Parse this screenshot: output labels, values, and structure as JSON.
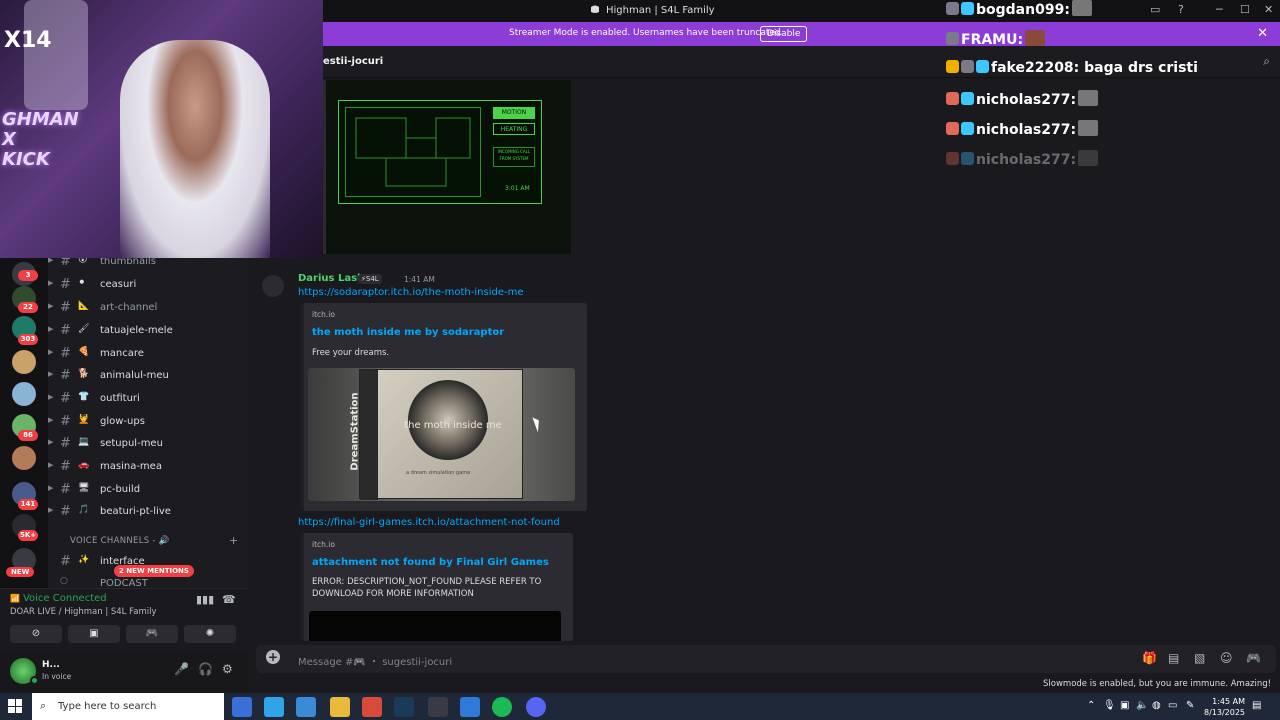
{
  "titlebar": {
    "title": "Highman | S4L Family",
    "minimize": "─",
    "maximize": "☐",
    "close": "✕"
  },
  "banner": {
    "text": "Streamer Mode is enabled. Usernames have been truncated.",
    "button": "Disable",
    "close": "✕"
  },
  "channel_header": {
    "name": "estii-jocuri"
  },
  "webcam": {
    "logo": "X14",
    "neon_text": "GHMAN\nX\nKICK"
  },
  "server_badges": [
    "3",
    "22",
    "303",
    "86",
    "141",
    "5K+"
  ],
  "channels": [
    {
      "emoji": "😲",
      "label": "thumbnails",
      "muted": true
    },
    {
      "emoji": "⚫",
      "label": "ceasuri",
      "muted": false
    },
    {
      "emoji": "📐",
      "label": "art-channel",
      "muted": true
    },
    {
      "emoji": "🖌",
      "label": "tatuajele-mele",
      "muted": false
    },
    {
      "emoji": "🍕",
      "label": "mancare",
      "muted": false
    },
    {
      "emoji": "🐕",
      "label": "animalul-meu",
      "muted": false
    },
    {
      "emoji": "👕",
      "label": "outfituri",
      "muted": false
    },
    {
      "emoji": "💆",
      "label": "glow-ups",
      "muted": false
    },
    {
      "emoji": "💻",
      "label": "setupul-meu",
      "muted": false
    },
    {
      "emoji": "🚗",
      "label": "masina-mea",
      "muted": false
    },
    {
      "emoji": "🖥",
      "label": "pc-build",
      "muted": false
    },
    {
      "emoji": "🎵",
      "label": "beaturi-pt-live",
      "muted": false
    }
  ],
  "voice_section": {
    "header": "VOICE CHANNELS - 🔊",
    "first_channel": "interface",
    "second_channel": "PODCAST"
  },
  "mentions_pill": "2 NEW MENTIONS",
  "new_pill": "NEW",
  "voice_panel": {
    "status": "Voice Connected",
    "room": "DOAR LIVE / Highman | S4L Family"
  },
  "user": {
    "name": "H...",
    "status": "In voice"
  },
  "monitor": {
    "motion": "MOTION",
    "heating": "HEATING",
    "note": "INCOMING CALL FROM SYSTEM",
    "time": "3:01 AM"
  },
  "message": {
    "author": "Darius Laslo",
    "tag": "⚡S4L",
    "time": "1:41 AM",
    "link1": "https://sodaraptor.itch.io/the-moth-inside-me",
    "embed1": {
      "provider": "itch.io",
      "title": "the moth inside me by sodaraptor",
      "description": "Free your dreams."
    },
    "cover": {
      "spine": "DreamStation",
      "title": "the moth inside me",
      "sub": "a dream simulation game"
    },
    "link2": "https://final-girl-games.itch.io/attachment-not-found",
    "embed2": {
      "provider": "itch.io",
      "title": "attachment not found by Final Girl Games",
      "description": "ERROR: DESCRIPTION_NOT_FOUND PLEASE REFER TO DOWNLOAD FOR MORE INFORMATION"
    }
  },
  "stream_chat": [
    {
      "user": "bogdan099:",
      "text": "",
      "pic": true
    },
    {
      "user": "FRAMU:",
      "text": "",
      "pic": true
    },
    {
      "user": "fake22208:",
      "text": "baga drs cristi",
      "pic": false
    },
    {
      "user": "nicholas277:",
      "text": "",
      "pic": true
    },
    {
      "user": "nicholas277:",
      "text": "",
      "pic": true
    },
    {
      "user": "nicholas277:",
      "text": "",
      "pic": true
    }
  ],
  "composer": {
    "placeholder": "Message #🎮 ・ sugestii-jocuri"
  },
  "slowmode": "Slowmode is enabled, but you are immune. Amazing!",
  "taskbar": {
    "search_placeholder": "Type here to search",
    "time": "1:45 AM",
    "date": "8/13/2025"
  }
}
